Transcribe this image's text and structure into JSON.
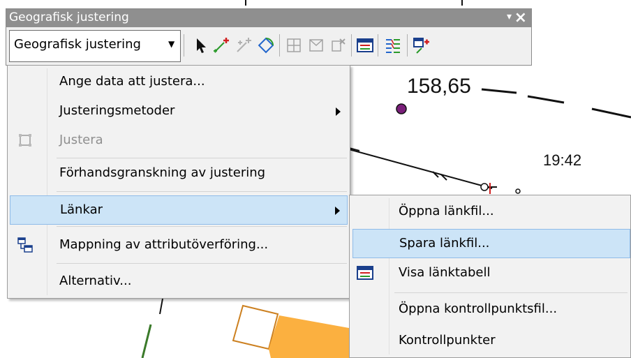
{
  "map": {
    "label_1": "158,65",
    "label_2": "19:42"
  },
  "toolbar": {
    "title": "Geografisk justering",
    "dropdown_label": "Geografisk justering",
    "icons": [
      "select-arrow-icon",
      "add-link-icon",
      "auto-link-icon",
      "rotate-icon",
      "grid-icon",
      "warp-icon",
      "delete-link-icon",
      "link-table-icon",
      "attribute-mapping-icon",
      "add-control-point-icon"
    ]
  },
  "main_menu": {
    "items": [
      {
        "label": "Ange data att justera..."
      },
      {
        "label": "Justeringsmetoder"
      },
      {
        "label": "Justera"
      },
      {
        "label": "Förhandsgranskning av justering"
      },
      {
        "label": "Länkar"
      },
      {
        "label": "Mappning av attributöverföring..."
      },
      {
        "label": "Alternativ..."
      }
    ]
  },
  "sub_menu": {
    "items": [
      {
        "label": "Öppna länkfil..."
      },
      {
        "label": "Spara länkfil..."
      },
      {
        "label": "Visa länktabell"
      },
      {
        "label": "Öppna kontrollpunktsfil..."
      },
      {
        "label": "Kontrollpunkter"
      }
    ]
  },
  "colors": {
    "title_bar": "#8f8f8f",
    "highlight": "#cce4f7",
    "highlight_border": "#8fbbe8",
    "map_point": "#7a1f7a",
    "map_polygon": "#fbb040"
  }
}
